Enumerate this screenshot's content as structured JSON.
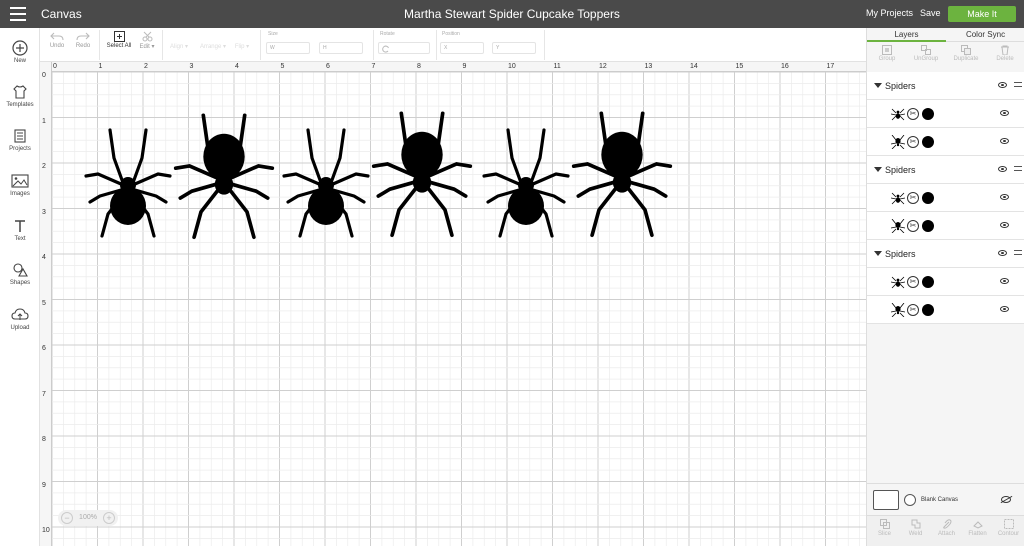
{
  "header": {
    "app_title": "Canvas",
    "project_title": "Martha Stewart Spider Cupcake Toppers",
    "my_projects": "My Projects",
    "save": "Save",
    "make_it": "Make It",
    "make_it_color": "#6cb33f"
  },
  "sidebar": {
    "items": [
      {
        "label": "New",
        "icon": "plus-circle-icon"
      },
      {
        "label": "Templates",
        "icon": "shirt-icon"
      },
      {
        "label": "Projects",
        "icon": "projects-icon"
      },
      {
        "label": "Images",
        "icon": "image-icon"
      },
      {
        "label": "Text",
        "icon": "text-icon"
      },
      {
        "label": "Shapes",
        "icon": "shapes-icon"
      },
      {
        "label": "Upload",
        "icon": "upload-icon"
      }
    ]
  },
  "toolbar": {
    "undo": "Undo",
    "redo": "Redo",
    "select_all": "Select All",
    "edit": "Edit",
    "align": "Align",
    "arrange": "Arrange",
    "flip": "Flip",
    "size_label": "Size",
    "w_label": "W",
    "h_label": "H",
    "rotate_label": "Rotate",
    "position_label": "Position",
    "x_label": "X",
    "y_label": "Y"
  },
  "ruler": {
    "top": [
      "0",
      "1",
      "2",
      "3",
      "4",
      "5",
      "6",
      "7",
      "8",
      "9",
      "10",
      "11",
      "12",
      "13",
      "14",
      "15",
      "16",
      "17"
    ],
    "left": [
      "0",
      "1",
      "2",
      "3",
      "4",
      "5",
      "6",
      "7",
      "8",
      "9",
      "10"
    ]
  },
  "zoom": {
    "value": "100%",
    "minus": "−",
    "plus": "+"
  },
  "layers_panel": {
    "tabs": [
      "Layers",
      "Color Sync"
    ],
    "actions": [
      "Group",
      "UnGroup",
      "Duplicate",
      "Delete"
    ],
    "groups": [
      {
        "name": "Spiders",
        "items": [
          {
            "cut": "✂"
          },
          {
            "cut": "✂"
          }
        ]
      },
      {
        "name": "Spiders",
        "items": [
          {
            "cut": "✂"
          },
          {
            "cut": "✂"
          }
        ]
      },
      {
        "name": "Spiders",
        "items": [
          {
            "cut": "✂"
          },
          {
            "cut": "✂"
          }
        ]
      }
    ],
    "blank_canvas": "Blank Canvas",
    "bottom_actions": [
      "Slice",
      "Weld",
      "Attach",
      "Flatten",
      "Contour"
    ]
  }
}
